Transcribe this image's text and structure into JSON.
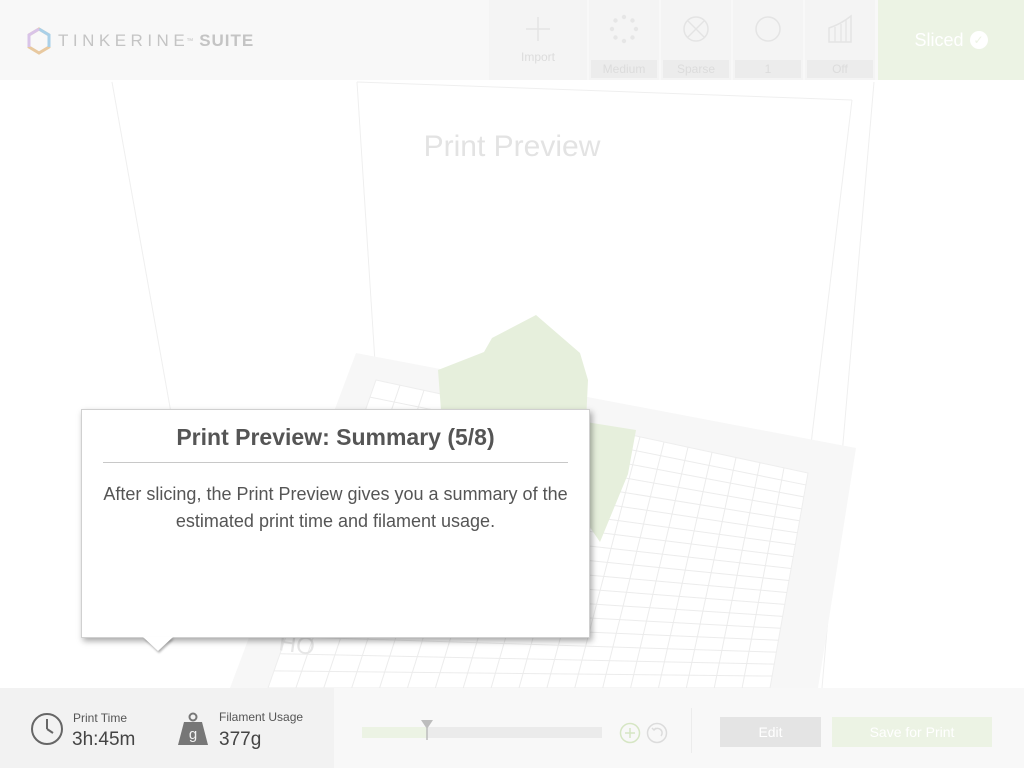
{
  "app": {
    "brand_word": "TINKERINE",
    "brand_tm": "™",
    "brand_suite": "SUITE"
  },
  "toolbar": {
    "import_label": "Import",
    "quality_label": "Medium",
    "infill_label": "Sparse",
    "shells_label": "1",
    "supports_label": "Off",
    "sliced_label": "Sliced",
    "sliced_icon": "check-circle-icon"
  },
  "viewport": {
    "title": "Print Preview"
  },
  "tooltip": {
    "title": "Print Preview: Summary (5/8)",
    "body": "After slicing, the Print Preview gives you a summary of the estimated print time and filament usage."
  },
  "summary": {
    "print_time_label": "Print Time",
    "print_time_value": "3h:45m",
    "filament_label": "Filament Usage",
    "filament_value": "377g",
    "filament_icon_glyph": "g"
  },
  "layer_slider": {
    "position": 0.27
  },
  "actions": {
    "edit_label": "Edit",
    "save_label": "Save for Print"
  },
  "colors": {
    "accent_green": "#ecf3e4",
    "model_green": "#e6efdc",
    "text_dark": "#555555"
  }
}
